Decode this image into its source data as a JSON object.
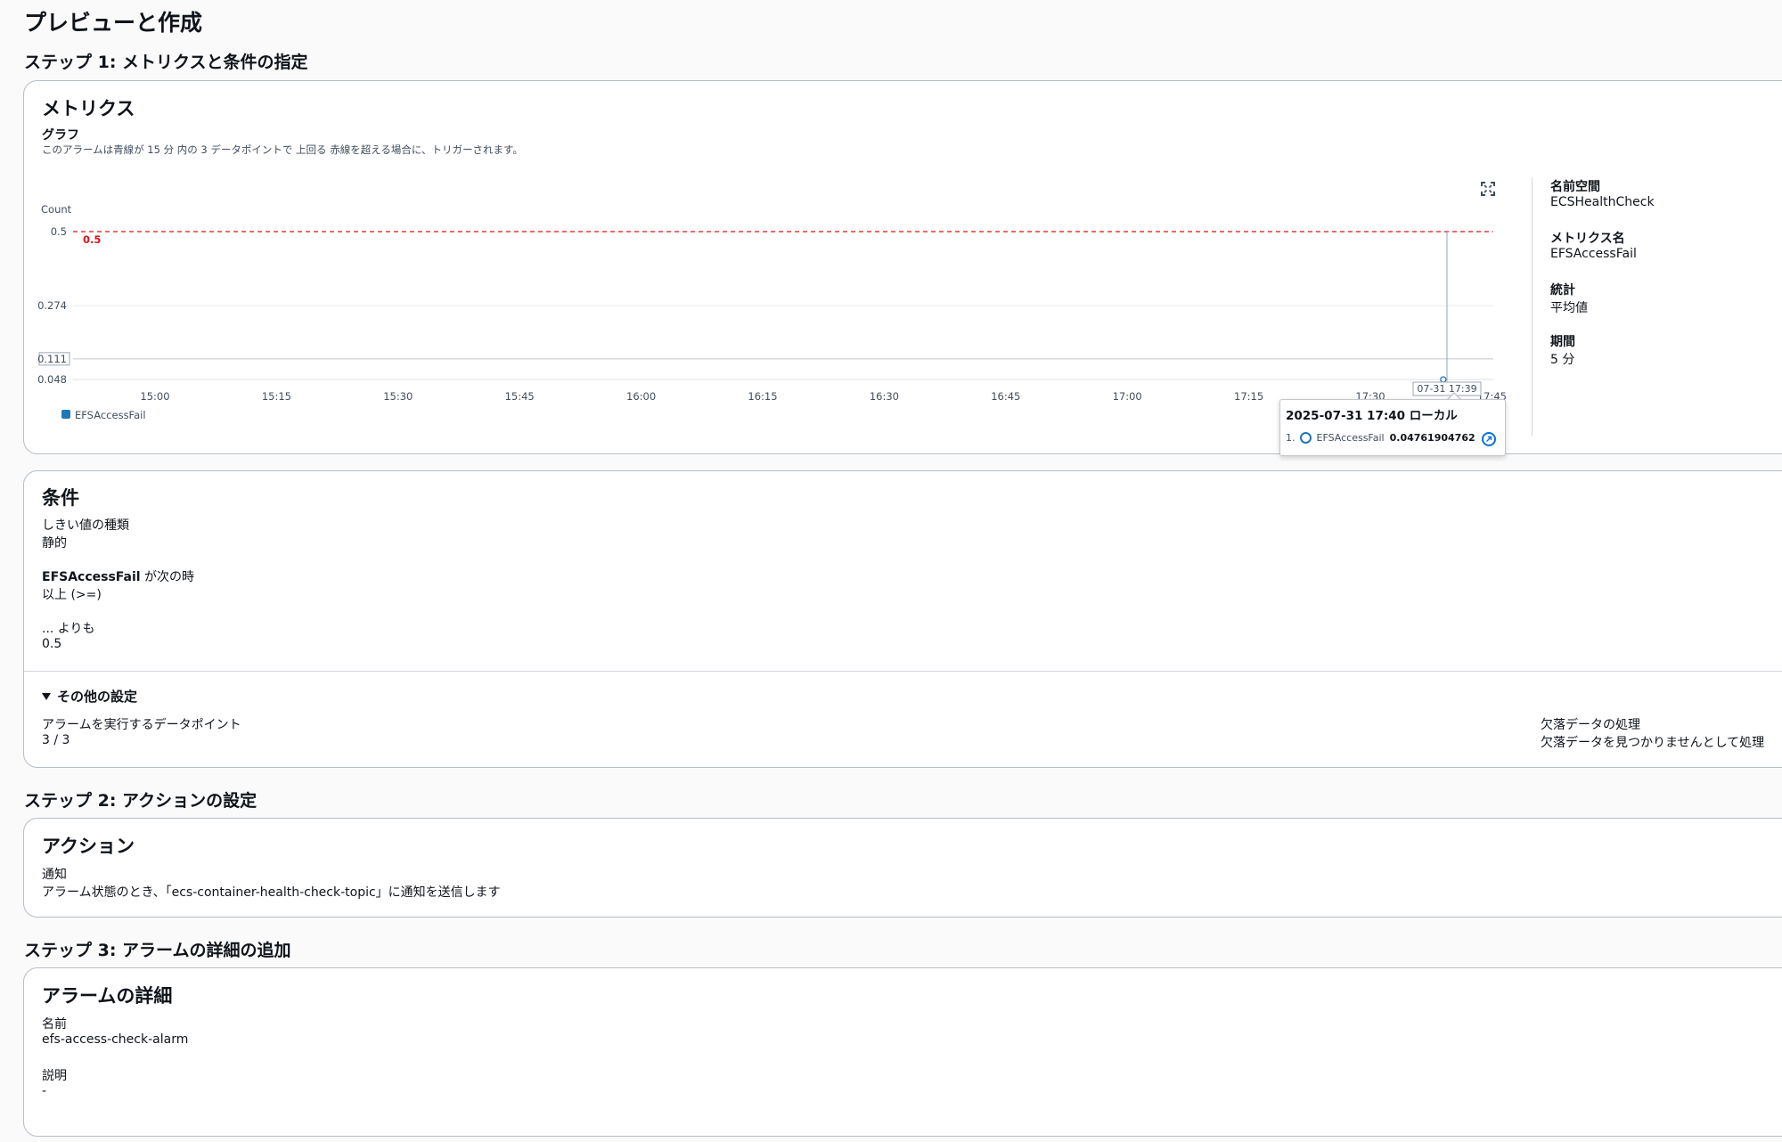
{
  "page_title": "プレビューと作成",
  "step1": {
    "title": "ステップ 1: メトリクスと条件の指定",
    "metrics_card": {
      "title": "メトリクス",
      "graph_label": "グラフ",
      "graph_description": "このアラームは青線が 15 分 内の 3 データポイントで 上回る 赤線を超える場合に、トリガーされます。",
      "expand_icon": "expand-icon",
      "details": [
        {
          "label": "名前空間",
          "value": "ECSHealthCheck"
        },
        {
          "label": "メトリクス名",
          "value": "EFSAccessFail"
        },
        {
          "label": "統計",
          "value": "平均値"
        },
        {
          "label": "期間",
          "value": "5 分"
        }
      ]
    },
    "condition_card": {
      "title": "条件",
      "threshold_type_label": "しきい値の種類",
      "threshold_type_value": "静的",
      "metric_name": "EFSAccessFail",
      "when_suffix": " が次の時",
      "operator_value": "以上 (>=)",
      "than_label": "... よりも",
      "than_value": "0.5",
      "other_settings_label": "その他の設定",
      "datapoints_label": "アラームを実行するデータポイント",
      "datapoints_value": "3 / 3",
      "missing_data_label": "欠落データの処理",
      "missing_data_value": "欠落データを見つかりませんとして処理"
    }
  },
  "step2": {
    "title": "ステップ 2: アクションの設定",
    "card": {
      "title": "アクション",
      "notification_label": "通知",
      "notification_value": "アラーム状態のとき、「ecs-container-health-check-topic」に通知を送信します"
    }
  },
  "step3": {
    "title": "ステップ 3: アラームの詳細の追加",
    "card": {
      "title": "アラームの詳細",
      "name_label": "名前",
      "name_value": "efs-access-check-alarm",
      "description_label": "説明",
      "description_value": "-"
    }
  },
  "chart_data": {
    "type": "line",
    "ylabel": "Count",
    "y_ticks": [
      "0.5",
      "0.274",
      "0.111",
      "0.048"
    ],
    "x_ticks": [
      "15:00",
      "15:15",
      "15:30",
      "15:45",
      "16:00",
      "16:15",
      "16:30",
      "16:45",
      "17:00",
      "17:15",
      "17:30",
      "17:45"
    ],
    "ylim": [
      0.048,
      0.5
    ],
    "threshold": {
      "value": 0.5,
      "label": "0.5",
      "color": "#d91515"
    },
    "series": [
      {
        "name": "EFSAccessFail",
        "color": "#1f77b4",
        "points": [
          {
            "x": "17:39",
            "y": 0.04761904762
          }
        ]
      }
    ],
    "crosshair_label": "07-31 17:39",
    "highlighted_y_label": "0.111",
    "legend_placement": "bottom-left",
    "grid": true,
    "tooltip": {
      "title": "2025-07-31 17:40 ローカル",
      "index": "1.",
      "series_name": "EFSAccessFail",
      "value": "0.04761904762"
    }
  }
}
